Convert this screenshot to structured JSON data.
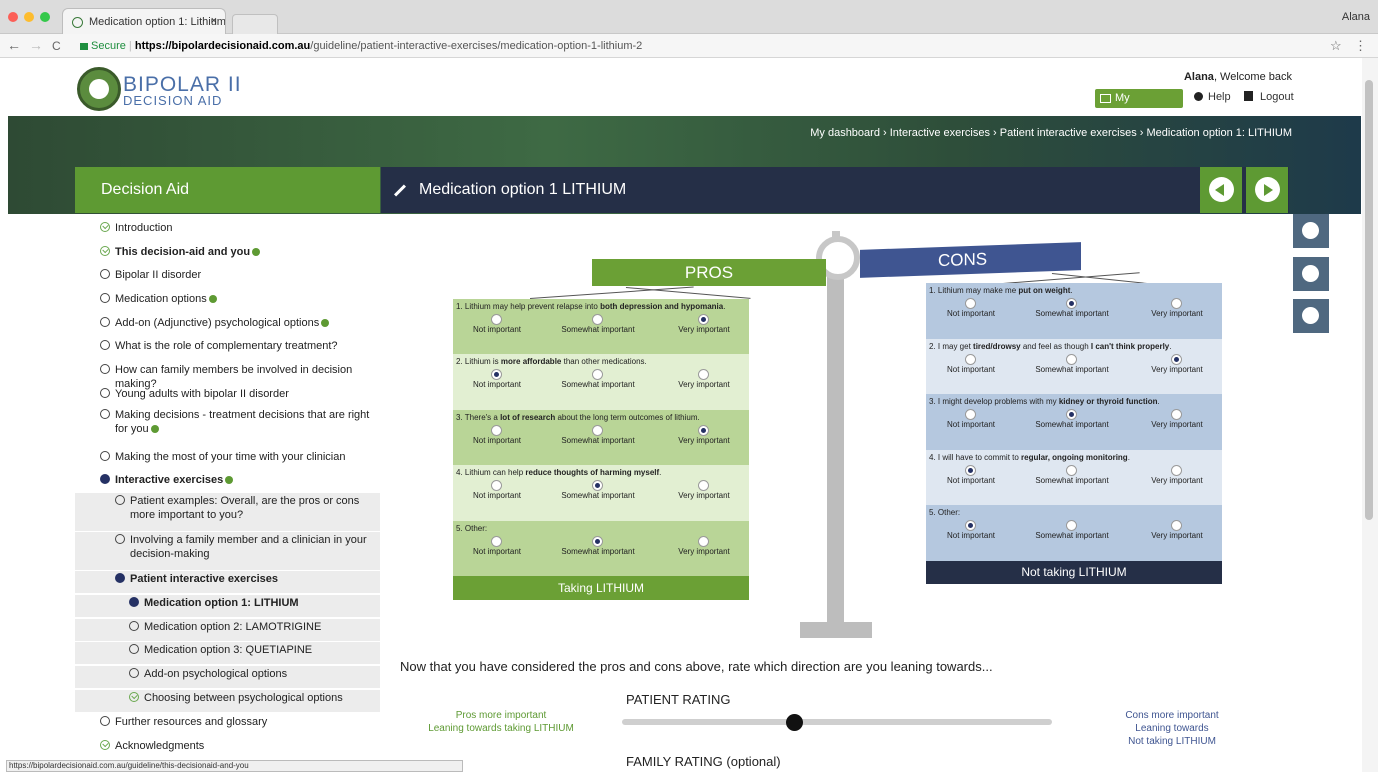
{
  "browser": {
    "tab_title": "Medication option 1: Lithium",
    "tab_close": "×",
    "user": "Alana",
    "secure_label": "Secure",
    "url_domain": "https://bipolardecisionaid.com.au",
    "url_path": "/guideline/patient-interactive-exercises/medication-option-1-lithium-2",
    "back": "←",
    "forward": "→",
    "reload": "C",
    "star": "☆",
    "menu": "⋮"
  },
  "header": {
    "logo_line1": "BIPOLAR II",
    "logo_line2": "DECISION AID",
    "welcome_name": "Alana",
    "welcome_text": ", Welcome back",
    "dashboard": "My dashboard",
    "help": "Help",
    "logout": "Logout"
  },
  "breadcrumb": "My dashboard › Interactive exercises › Patient interactive exercises › Medication option 1: LITHIUM",
  "sidebar": {
    "title": "Decision Aid",
    "items": [
      {
        "label": "Introduction",
        "state": "done"
      },
      {
        "label": "This decision-aid and you",
        "state": "done",
        "bold": true,
        "info": true
      },
      {
        "label": "Bipolar II disorder",
        "state": "empty"
      },
      {
        "label": "Medication options",
        "state": "empty",
        "info": true
      },
      {
        "label": "Add-on (Adjunctive) psychological options",
        "state": "empty",
        "info": true
      },
      {
        "label": "What is the role of complementary treatment?",
        "state": "empty"
      },
      {
        "label": "How can family members be involved in decision making?",
        "state": "empty"
      },
      {
        "label": "Young adults with bipolar II disorder",
        "state": "empty"
      },
      {
        "label": "Making decisions - treatment decisions that are right for you",
        "state": "empty",
        "info": true
      },
      {
        "label": "Making the most of your time with your clinician",
        "state": "empty"
      },
      {
        "label": "Interactive exercises",
        "state": "filled",
        "bold": true,
        "info": true
      },
      {
        "label": "Patient examples: Overall, are the pros or cons more important to you?",
        "state": "empty"
      },
      {
        "label": "Involving a family member and a clinician in your decision-making",
        "state": "empty"
      },
      {
        "label": "Patient interactive exercises",
        "state": "filled",
        "bold": true
      },
      {
        "label": "Medication option 1: LITHIUM",
        "state": "filled",
        "bold": true
      },
      {
        "label": "Medication option 2: LAMOTRIGINE",
        "state": "empty"
      },
      {
        "label": "Medication option 3: QUETIAPINE",
        "state": "empty"
      },
      {
        "label": "Add-on psychological options",
        "state": "empty"
      },
      {
        "label": "Choosing between psychological options",
        "state": "done"
      },
      {
        "label": "Further resources and glossary",
        "state": "empty"
      },
      {
        "label": "Acknowledgments",
        "state": "done"
      }
    ]
  },
  "exercise": {
    "title": "Medication option 1 LITHIUM",
    "pros_label": "PROS",
    "cons_label": "CONS",
    "pros_footer": "Taking LITHIUM",
    "cons_footer": "Not taking LITHIUM"
  },
  "options": [
    "Not important",
    "Somewhat important",
    "Very important"
  ],
  "pros": [
    {
      "pre": "1. Lithium may help prevent relapse into ",
      "bold": "both depression and hypomania",
      "post": ".",
      "selected": 2
    },
    {
      "pre": "2. Lithium is ",
      "bold": "more affordable",
      "post": " than other medications.",
      "selected": 0
    },
    {
      "pre": "3. There's a ",
      "bold": "lot of research",
      "post": " about the long term outcomes of lithium.",
      "selected": 2
    },
    {
      "pre": "4. Lithium can help ",
      "bold": "reduce thoughts of harming myself",
      "post": ".",
      "selected": 1
    },
    {
      "pre": "5. Other:",
      "bold": "",
      "post": "",
      "selected": 1
    }
  ],
  "cons": [
    {
      "pre": "1. Lithium may make me ",
      "bold": "put on weight",
      "post": ".",
      "selected": 1
    },
    {
      "pre": "2. I may get ",
      "bold": "tired/drowsy",
      "post": " and feel as though ",
      "bold2": "I can't think properly",
      "post2": ".",
      "selected": 2
    },
    {
      "pre": "3. I might develop problems with my ",
      "bold": "kidney or thyroid function",
      "post": ".",
      "selected": 1
    },
    {
      "pre": "4. I will have to commit to ",
      "bold": "regular, ongoing monitoring",
      "post": ".",
      "selected": 0
    },
    {
      "pre": "5. Other:",
      "bold": "",
      "post": "",
      "selected": 0
    }
  ],
  "rating": {
    "question": "Now that you have considered the pros and cons above, rate which direction are you leaning towards...",
    "patient_title": "PATIENT RATING",
    "left_line1": "Pros more important",
    "left_line2": "Leaning towards taking LITHIUM",
    "right_line1": "Cons more important",
    "right_line2": "Leaning towards",
    "right_line3": "Not taking LITHIUM",
    "family_title": "FAMILY RATING (optional)",
    "patient_value": 0.4
  },
  "status_url": "https://bipolardecisionaid.com.au/guideline/this-decisionaid-and-you",
  "colors": {
    "green": "#6ba035",
    "navy": "#252f47",
    "blue": "#3f5591",
    "pros_bg1": "#b9d597",
    "pros_bg2": "#e2efd2",
    "cons_bg1": "#b5c8df",
    "cons_bg2": "#dfe7f1"
  }
}
